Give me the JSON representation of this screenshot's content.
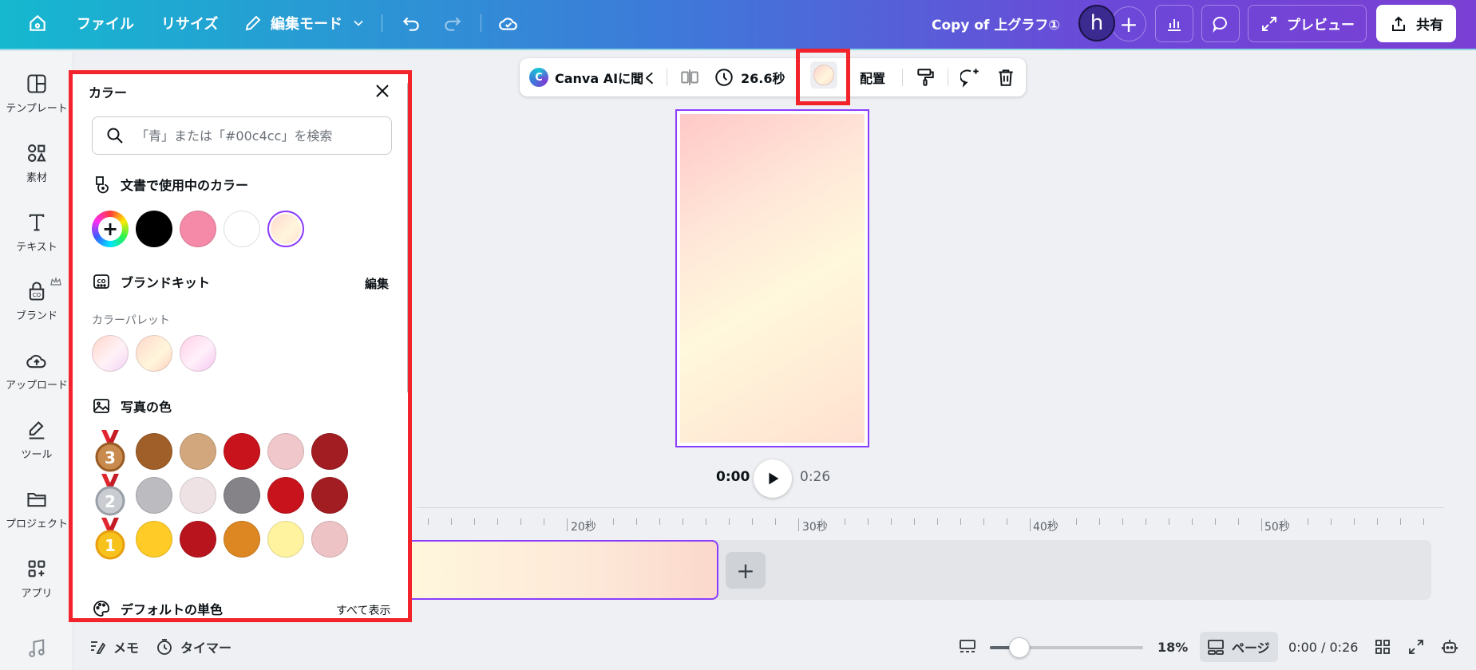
{
  "topbar": {
    "file": "ファイル",
    "resize": "リサイズ",
    "edit_mode": "編集モード",
    "doc_title": "Copy of 上グラフ①",
    "avatar_initial": "h",
    "preview": "プレビュー",
    "share": "共有"
  },
  "sidebar": {
    "items": [
      {
        "label": "テンプレート"
      },
      {
        "label": "素材"
      },
      {
        "label": "テキスト"
      },
      {
        "label": "ブランド"
      },
      {
        "label": "アップロード"
      },
      {
        "label": "ツール"
      },
      {
        "label": "プロジェクト"
      },
      {
        "label": "アプリ"
      }
    ]
  },
  "color_panel": {
    "title": "カラー",
    "search_placeholder": "「青」または「#00c4cc」を検索",
    "doc_colors_title": "文書で使用中のカラー",
    "doc_colors": [
      "#000000",
      "#f48aa8",
      "#ffffff",
      "linear-gradient(135deg,#ffd6d0,#fff6dc 60%,#ffdccc)"
    ],
    "brand_kit_title": "ブランドキット",
    "brand_kit_edit": "編集",
    "palette_label": "カラーパレット",
    "palette": [
      "linear-gradient(135deg,#ffd6cc,#fff2f6 55%,#f3d3f6)",
      "linear-gradient(135deg,#ffd8cc,#fff6dc 60%,#ffd0c0)",
      "linear-gradient(135deg,#ffd0e8,#fff0fa 55%,#f6c6f0)"
    ],
    "photo_colors_title": "写真の色",
    "photo_rows": [
      {
        "medal": "3",
        "colors": [
          "#a05f28",
          "#d2a77d",
          "#c8131c",
          "#f0c8cc",
          "#a11d22"
        ]
      },
      {
        "medal": "2",
        "colors": [
          "#bcbbbf",
          "#efe2e4",
          "#858388",
          "#c8131c",
          "#a11d22"
        ]
      },
      {
        "medal": "1",
        "colors": [
          "#ffcb26",
          "#b8141e",
          "#dd8722",
          "#fff3a0",
          "#edc3c6"
        ]
      }
    ],
    "default_solid_title": "デフォルトの単色",
    "show_all": "すべて表示"
  },
  "toolbar": {
    "ask_ai": "Canva AIに聞く",
    "duration": "26.6秒",
    "position": "配置"
  },
  "playback": {
    "current": "0:00",
    "total": "0:26"
  },
  "timeline": {
    "ruler": [
      "20秒",
      "30秒",
      "40秒",
      "50秒"
    ]
  },
  "bottombar": {
    "notes": "メモ",
    "timer": "タイマー",
    "zoom": "18%",
    "zoom_fraction": 0.18,
    "pages": "ページ",
    "time": "0:00 / 0:26"
  },
  "colors": {
    "accent": "#8b3dff",
    "highlight": "#f2232b"
  }
}
